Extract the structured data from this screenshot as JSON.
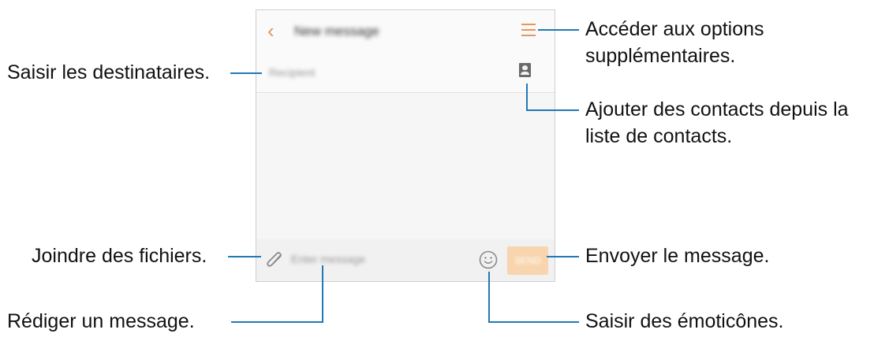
{
  "screen": {
    "title": "New message",
    "recipient_placeholder": "Recipient",
    "message_placeholder": "Enter message",
    "send_label": "SEND",
    "accent_color": "#e8945a",
    "send_button_color": "#f8d5ae"
  },
  "icons": {
    "back": "chevron-left-icon",
    "menu": "menu-icon",
    "contacts": "contact-icon",
    "attach": "paperclip-icon",
    "emoji": "emoji-icon"
  },
  "callouts": {
    "more_options": "Accéder aux options\nsupplémentaires.",
    "recipients": "Saisir les destinataires.",
    "add_contacts": "Ajouter des contacts depuis la\nliste de contacts.",
    "attach_files": "Joindre des fichiers.",
    "send": "Envoyer le message.",
    "compose": "Rédiger un message.",
    "emoticons": "Saisir des émoticônes."
  },
  "colors": {
    "callout_line": "#1f79b6"
  }
}
